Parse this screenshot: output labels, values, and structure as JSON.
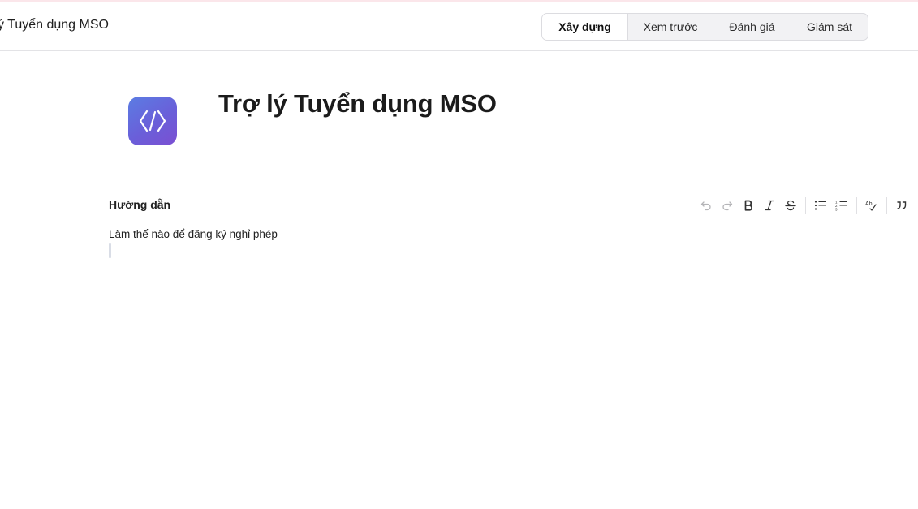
{
  "header": {
    "app_title": "ý Tuyển dụng MSO",
    "tabs": [
      {
        "label": "Xây dựng",
        "active": true
      },
      {
        "label": "Xem trước",
        "active": false
      },
      {
        "label": "Đánh giá",
        "active": false
      },
      {
        "label": "Giám sát",
        "active": false
      }
    ]
  },
  "agent": {
    "title": "Trợ lý Tuyển dụng MSO",
    "logo_icon": "code-brackets-icon",
    "logo_colors": [
      "#5b7de3",
      "#7b4fd2"
    ]
  },
  "instructions": {
    "label": "Hướng dẫn",
    "text": "Làm thế nào để đăng ký nghỉ phép"
  },
  "toolbar": {
    "icons": [
      "undo-icon",
      "redo-icon",
      "bold-icon",
      "italic-icon",
      "strikethrough-icon",
      "bulleted-list-icon",
      "numbered-list-icon",
      "spellcheck-icon",
      "quote-icon"
    ]
  }
}
